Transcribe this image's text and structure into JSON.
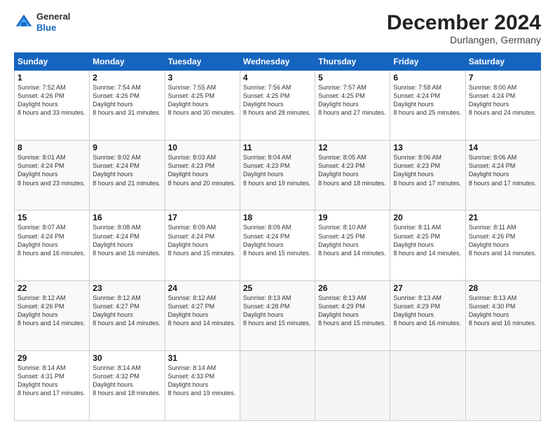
{
  "header": {
    "logo": {
      "line1": "General",
      "line2": "Blue"
    },
    "title": "December 2024",
    "location": "Durlangen, Germany"
  },
  "weekdays": [
    "Sunday",
    "Monday",
    "Tuesday",
    "Wednesday",
    "Thursday",
    "Friday",
    "Saturday"
  ],
  "weeks": [
    [
      {
        "day": 1,
        "sunrise": "7:52 AM",
        "sunset": "4:26 PM",
        "daylight": "8 hours and 33 minutes."
      },
      {
        "day": 2,
        "sunrise": "7:54 AM",
        "sunset": "4:26 PM",
        "daylight": "8 hours and 31 minutes."
      },
      {
        "day": 3,
        "sunrise": "7:55 AM",
        "sunset": "4:25 PM",
        "daylight": "8 hours and 30 minutes."
      },
      {
        "day": 4,
        "sunrise": "7:56 AM",
        "sunset": "4:25 PM",
        "daylight": "8 hours and 28 minutes."
      },
      {
        "day": 5,
        "sunrise": "7:57 AM",
        "sunset": "4:25 PM",
        "daylight": "8 hours and 27 minutes."
      },
      {
        "day": 6,
        "sunrise": "7:58 AM",
        "sunset": "4:24 PM",
        "daylight": "8 hours and 25 minutes."
      },
      {
        "day": 7,
        "sunrise": "8:00 AM",
        "sunset": "4:24 PM",
        "daylight": "8 hours and 24 minutes."
      }
    ],
    [
      {
        "day": 8,
        "sunrise": "8:01 AM",
        "sunset": "4:24 PM",
        "daylight": "8 hours and 23 minutes."
      },
      {
        "day": 9,
        "sunrise": "8:02 AM",
        "sunset": "4:24 PM",
        "daylight": "8 hours and 21 minutes."
      },
      {
        "day": 10,
        "sunrise": "8:03 AM",
        "sunset": "4:23 PM",
        "daylight": "8 hours and 20 minutes."
      },
      {
        "day": 11,
        "sunrise": "8:04 AM",
        "sunset": "4:23 PM",
        "daylight": "8 hours and 19 minutes."
      },
      {
        "day": 12,
        "sunrise": "8:05 AM",
        "sunset": "4:23 PM",
        "daylight": "8 hours and 18 minutes."
      },
      {
        "day": 13,
        "sunrise": "8:06 AM",
        "sunset": "4:23 PM",
        "daylight": "8 hours and 17 minutes."
      },
      {
        "day": 14,
        "sunrise": "8:06 AM",
        "sunset": "4:24 PM",
        "daylight": "8 hours and 17 minutes."
      }
    ],
    [
      {
        "day": 15,
        "sunrise": "8:07 AM",
        "sunset": "4:24 PM",
        "daylight": "8 hours and 16 minutes."
      },
      {
        "day": 16,
        "sunrise": "8:08 AM",
        "sunset": "4:24 PM",
        "daylight": "8 hours and 16 minutes."
      },
      {
        "day": 17,
        "sunrise": "8:09 AM",
        "sunset": "4:24 PM",
        "daylight": "8 hours and 15 minutes."
      },
      {
        "day": 18,
        "sunrise": "8:09 AM",
        "sunset": "4:24 PM",
        "daylight": "8 hours and 15 minutes."
      },
      {
        "day": 19,
        "sunrise": "8:10 AM",
        "sunset": "4:25 PM",
        "daylight": "8 hours and 14 minutes."
      },
      {
        "day": 20,
        "sunrise": "8:11 AM",
        "sunset": "4:25 PM",
        "daylight": "8 hours and 14 minutes."
      },
      {
        "day": 21,
        "sunrise": "8:11 AM",
        "sunset": "4:26 PM",
        "daylight": "8 hours and 14 minutes."
      }
    ],
    [
      {
        "day": 22,
        "sunrise": "8:12 AM",
        "sunset": "4:26 PM",
        "daylight": "8 hours and 14 minutes."
      },
      {
        "day": 23,
        "sunrise": "8:12 AM",
        "sunset": "4:27 PM",
        "daylight": "8 hours and 14 minutes."
      },
      {
        "day": 24,
        "sunrise": "8:12 AM",
        "sunset": "4:27 PM",
        "daylight": "8 hours and 14 minutes."
      },
      {
        "day": 25,
        "sunrise": "8:13 AM",
        "sunset": "4:28 PM",
        "daylight": "8 hours and 15 minutes."
      },
      {
        "day": 26,
        "sunrise": "8:13 AM",
        "sunset": "4:29 PM",
        "daylight": "8 hours and 15 minutes."
      },
      {
        "day": 27,
        "sunrise": "8:13 AM",
        "sunset": "4:29 PM",
        "daylight": "8 hours and 16 minutes."
      },
      {
        "day": 28,
        "sunrise": "8:13 AM",
        "sunset": "4:30 PM",
        "daylight": "8 hours and 16 minutes."
      }
    ],
    [
      {
        "day": 29,
        "sunrise": "8:14 AM",
        "sunset": "4:31 PM",
        "daylight": "8 hours and 17 minutes."
      },
      {
        "day": 30,
        "sunrise": "8:14 AM",
        "sunset": "4:32 PM",
        "daylight": "8 hours and 18 minutes."
      },
      {
        "day": 31,
        "sunrise": "8:14 AM",
        "sunset": "4:33 PM",
        "daylight": "8 hours and 19 minutes."
      },
      null,
      null,
      null,
      null
    ]
  ]
}
